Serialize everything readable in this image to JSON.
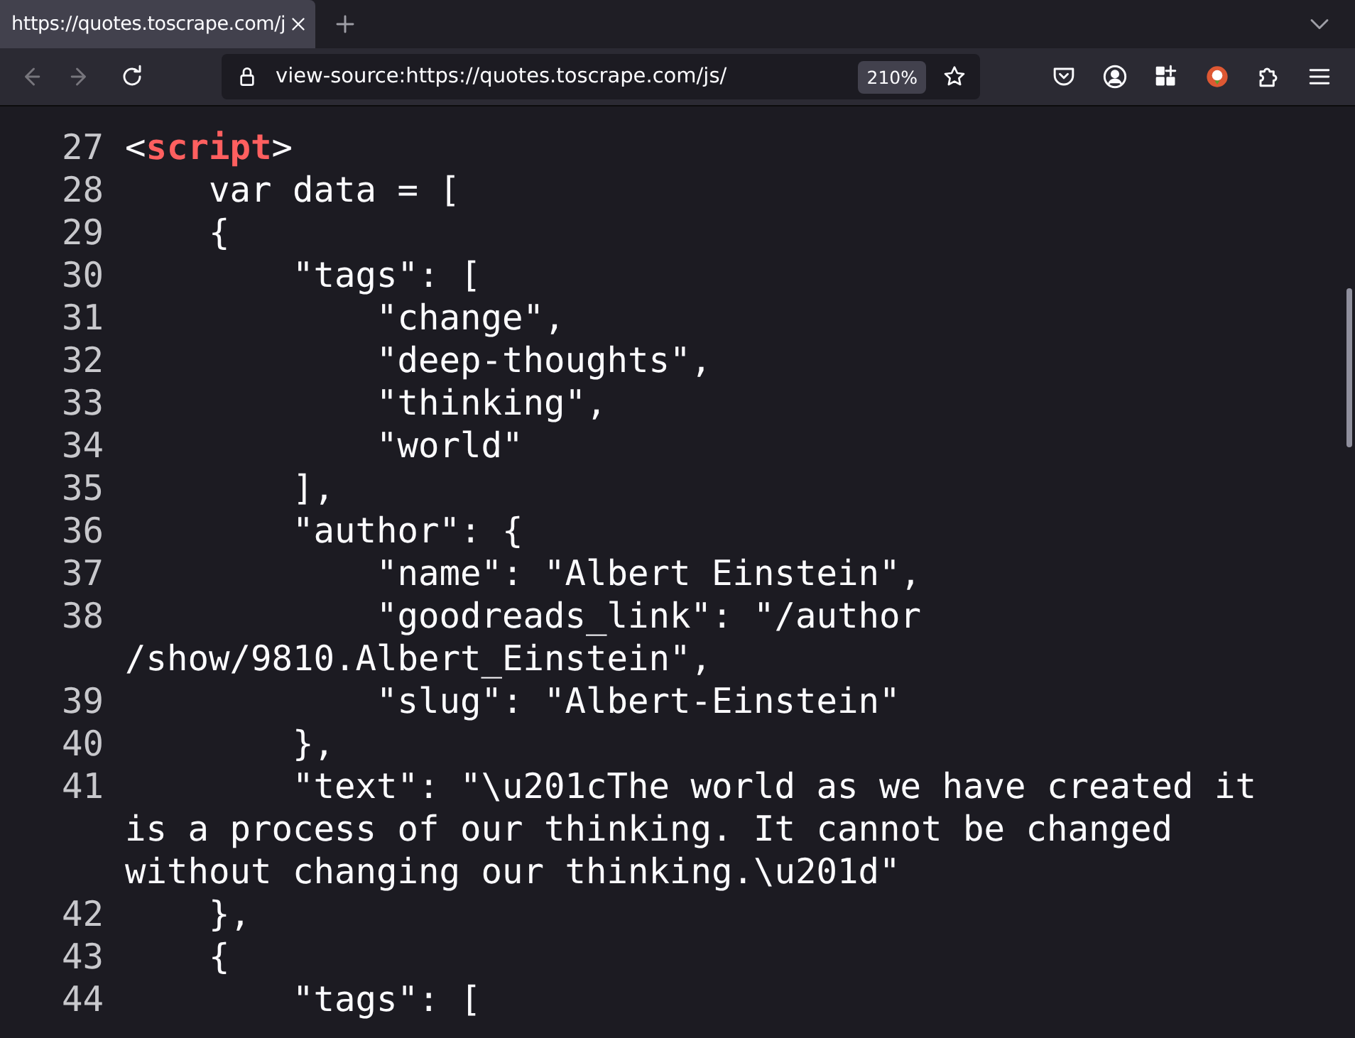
{
  "tabs": [
    {
      "title": "https://quotes.toscrape.com/j",
      "selected": true
    }
  ],
  "toolbar": {
    "url": "view-source:https://quotes.toscrape.com/js/",
    "zoom": "210%"
  },
  "source": {
    "lines": [
      {
        "number": "27",
        "rows": [
          [
            {
              "kind": "plain",
              "text": "<"
            },
            {
              "kind": "tag",
              "text": "script"
            },
            {
              "kind": "plain",
              "text": ">"
            }
          ]
        ]
      },
      {
        "number": "28",
        "rows": [
          [
            {
              "kind": "plain",
              "text": "    var data = ["
            }
          ]
        ]
      },
      {
        "number": "29",
        "rows": [
          [
            {
              "kind": "plain",
              "text": "    {"
            }
          ]
        ]
      },
      {
        "number": "30",
        "rows": [
          [
            {
              "kind": "plain",
              "text": "        \"tags\": ["
            }
          ]
        ]
      },
      {
        "number": "31",
        "rows": [
          [
            {
              "kind": "plain",
              "text": "            \"change\","
            }
          ]
        ]
      },
      {
        "number": "32",
        "rows": [
          [
            {
              "kind": "plain",
              "text": "            \"deep-thoughts\","
            }
          ]
        ]
      },
      {
        "number": "33",
        "rows": [
          [
            {
              "kind": "plain",
              "text": "            \"thinking\","
            }
          ]
        ]
      },
      {
        "number": "34",
        "rows": [
          [
            {
              "kind": "plain",
              "text": "            \"world\""
            }
          ]
        ]
      },
      {
        "number": "35",
        "rows": [
          [
            {
              "kind": "plain",
              "text": "        ],"
            }
          ]
        ]
      },
      {
        "number": "36",
        "rows": [
          [
            {
              "kind": "plain",
              "text": "        \"author\": {"
            }
          ]
        ]
      },
      {
        "number": "37",
        "rows": [
          [
            {
              "kind": "plain",
              "text": "            \"name\": \"Albert Einstein\","
            }
          ]
        ]
      },
      {
        "number": "38",
        "rows": [
          [
            {
              "kind": "plain",
              "text": "            \"goodreads_link\": \"/author"
            }
          ],
          [
            {
              "kind": "plain",
              "text": "/show/9810.Albert_Einstein\","
            }
          ]
        ]
      },
      {
        "number": "39",
        "rows": [
          [
            {
              "kind": "plain",
              "text": "            \"slug\": \"Albert-Einstein\""
            }
          ]
        ]
      },
      {
        "number": "40",
        "rows": [
          [
            {
              "kind": "plain",
              "text": "        },"
            }
          ]
        ]
      },
      {
        "number": "41",
        "rows": [
          [
            {
              "kind": "plain",
              "text": "        \"text\": \"\\u201cThe world as we have created it"
            }
          ],
          [
            {
              "kind": "plain",
              "text": "is a process of our thinking. It cannot be changed"
            }
          ],
          [
            {
              "kind": "plain",
              "text": "without changing our thinking.\\u201d\""
            }
          ]
        ]
      },
      {
        "number": "42",
        "rows": [
          [
            {
              "kind": "plain",
              "text": "    },"
            }
          ]
        ]
      },
      {
        "number": "43",
        "rows": [
          [
            {
              "kind": "plain",
              "text": "    {"
            }
          ]
        ]
      },
      {
        "number": "44",
        "rows": [
          [
            {
              "kind": "plain",
              "text": "        \"tags\": ["
            }
          ]
        ]
      }
    ]
  }
}
